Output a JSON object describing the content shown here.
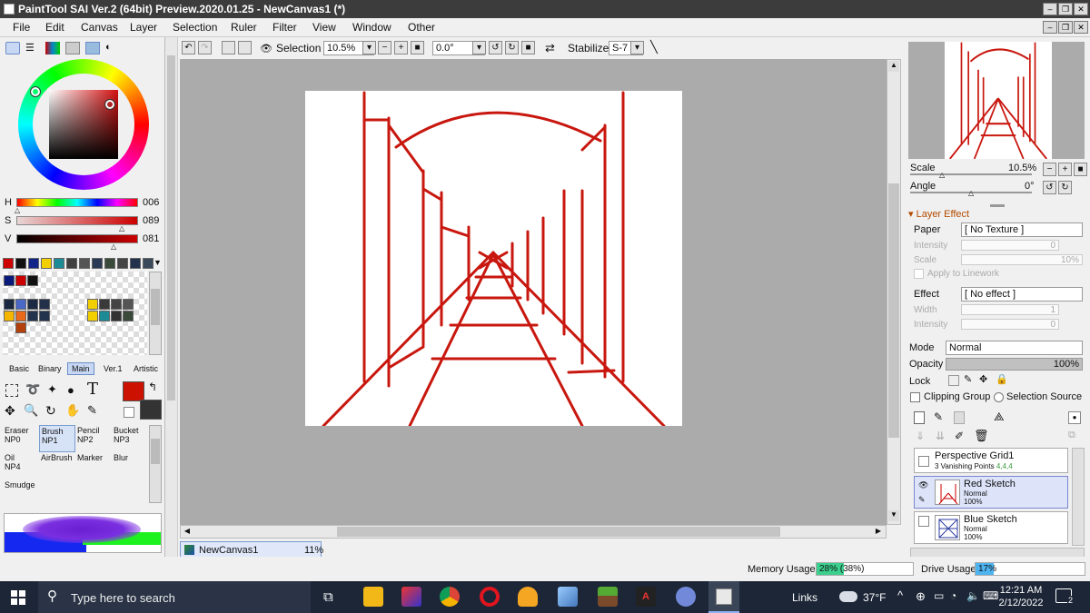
{
  "app": {
    "title": "PaintTool SAI Ver.2 (64bit) Preview.2020.01.25 - NewCanvas1 (*)"
  },
  "menu": [
    "File",
    "Edit",
    "Canvas",
    "Layer",
    "Selection",
    "Ruler",
    "Filter",
    "View",
    "Window",
    "Other"
  ],
  "toolbar": {
    "selection_label": "Selection",
    "zoom": "10.5%",
    "angle": "0.0°",
    "stabilizer_label": "Stabilizer",
    "stabilizer_value": "S-7"
  },
  "color": {
    "h_label": "H",
    "h": "006",
    "s_label": "S",
    "s": "089",
    "v_label": "V",
    "v": "081",
    "current": "#cc1100"
  },
  "tool_tabs": [
    "Basic",
    "Binary",
    "Main",
    "Ver.1",
    "Artistic"
  ],
  "brush_tools": [
    {
      "name": "Eraser",
      "sub": "NP0"
    },
    {
      "name": "Brush",
      "sub": "NP1"
    },
    {
      "name": "Pencil",
      "sub": "NP2"
    },
    {
      "name": "Bucket",
      "sub": "NP3"
    },
    {
      "name": "Oil",
      "sub": "NP4"
    },
    {
      "name": "AirBrush",
      "sub": ""
    },
    {
      "name": "Marker",
      "sub": ""
    },
    {
      "name": "Blur",
      "sub": ""
    },
    {
      "name": "Smudge",
      "sub": ""
    }
  ],
  "navigator": {
    "scale_label": "Scale",
    "scale": "10.5%",
    "angle_label": "Angle",
    "angle": "0°"
  },
  "layer_effect": {
    "header": "Layer Effect",
    "paper_label": "Paper",
    "paper": "[ No Texture ]",
    "intensity_label": "Intensity",
    "intensity": "0",
    "scale_label": "Scale",
    "scale": "10%",
    "apply_label": "Apply to Linework",
    "effect_label": "Effect",
    "effect": "[ No effect ]",
    "width_label": "Width",
    "width": "1",
    "intensity2_label": "Intensity",
    "intensity2": "0"
  },
  "layer_props": {
    "mode_label": "Mode",
    "mode": "Normal",
    "opacity_label": "Opacity",
    "opacity": "100%",
    "lock_label": "Lock",
    "clipping_label": "Clipping Group",
    "selection_source_label": "Selection Source"
  },
  "layers": [
    {
      "name": "Perspective Grid1",
      "line2": "3 Vanishing Points",
      "line2_extra": "4,4,4",
      "line3": ""
    },
    {
      "name": "Red Sketch",
      "line2": "Normal",
      "line2_extra": "",
      "line3": "100%"
    },
    {
      "name": "Blue Sketch",
      "line2": "Normal",
      "line2_extra": "",
      "line3": "100%"
    }
  ],
  "doc_tab": {
    "name": "NewCanvas1",
    "zoom": "11%"
  },
  "status": {
    "memory_label": "Memory Usage",
    "memory": "28% (38%)",
    "memory_frac": 0.28,
    "drive_label": "Drive Usage",
    "drive": "17%",
    "drive_frac": 0.17
  },
  "taskbar": {
    "search_placeholder": "Type here to search",
    "links": "Links",
    "temp": "37°F",
    "time": "12:21 AM",
    "date": "2/12/2022",
    "notif_count": "2"
  }
}
